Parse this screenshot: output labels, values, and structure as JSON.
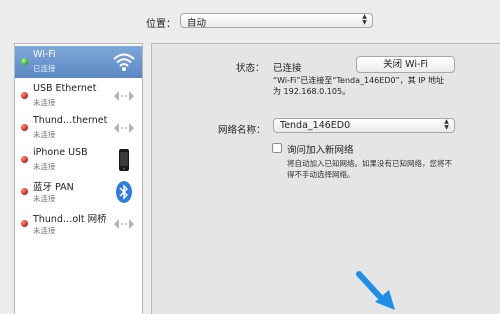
{
  "location": {
    "label": "位置：",
    "value": "自动"
  },
  "sidebar": {
    "items": [
      {
        "name": "Wi-Fi",
        "status": "已连接",
        "dot": "green",
        "icon": "wifi-icon",
        "selected": true
      },
      {
        "name": "USB Ethernet",
        "status": "未连接",
        "dot": "red",
        "icon": "ethernet-arrows-icon"
      },
      {
        "name": "Thund…thernet",
        "status": "未连接",
        "dot": "red",
        "icon": "ethernet-arrows-icon"
      },
      {
        "name": "iPhone USB",
        "status": "未连接",
        "dot": "red",
        "icon": "iphone-icon"
      },
      {
        "name": "蓝牙 PAN",
        "status": "未连接",
        "dot": "red",
        "icon": "bluetooth-icon"
      },
      {
        "name": "Thund…olt 网桥",
        "status": "未连接",
        "dot": "red",
        "icon": "ethernet-arrows-icon"
      }
    ]
  },
  "detail": {
    "status_label": "状态：",
    "status_value": "已连接",
    "wifi_button": "关闭 Wi-Fi",
    "status_desc_line1": "“Wi-Fi”已连接至“Tenda_146ED0”，其 IP 地址",
    "status_desc_line2": "为 192.168.0.105。",
    "network_label": "网络名称：",
    "network_value": "Tenda_146ED0",
    "ask_label": "询问加入新网络",
    "ask_desc_line1": "将自动加入已知网络。如果没有已知网络，您将不",
    "ask_desc_line2": "得不手动选择网络。"
  },
  "colors": {
    "selected_row": "#6b94cb",
    "arrow": "#1e8fe8",
    "status_red": "#d9251c",
    "status_green": "#3cb82a"
  }
}
